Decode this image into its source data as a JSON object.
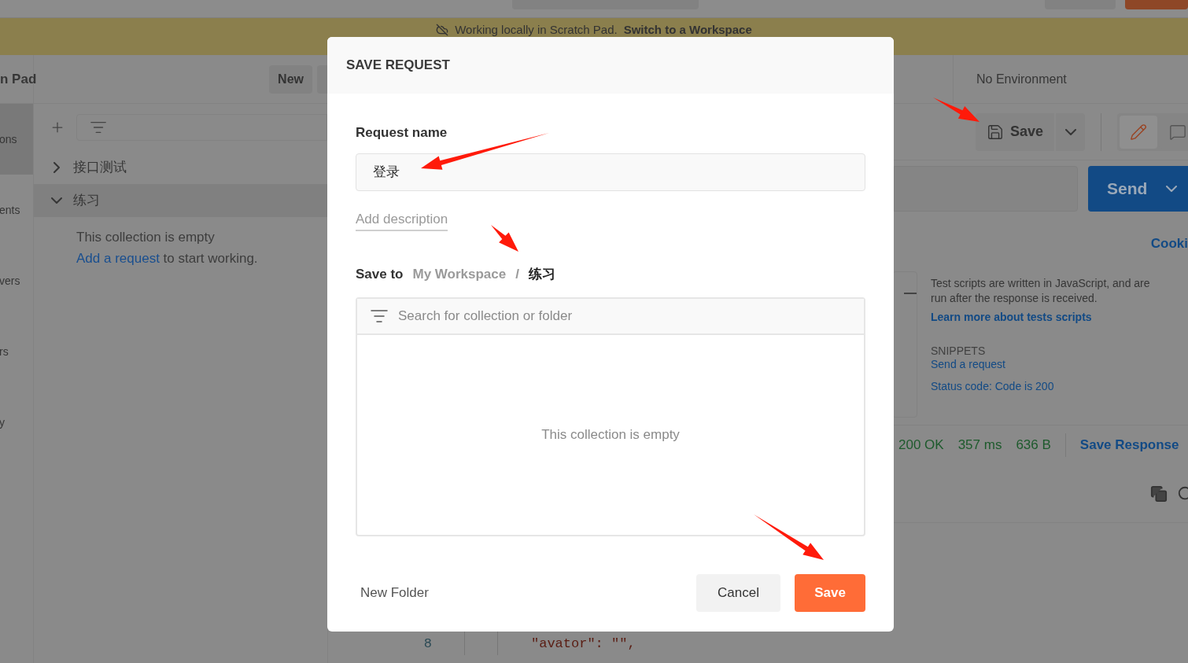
{
  "banner": {
    "text": "Working locally in Scratch Pad.",
    "link": "Switch to a Workspace"
  },
  "sidebar": {
    "items": [
      {
        "label": "ons",
        "selected": true
      },
      {
        "label": "ents",
        "selected": false
      },
      {
        "label": "vers",
        "selected": false
      },
      {
        "label": "rs",
        "selected": false
      },
      {
        "label": "y",
        "selected": false
      }
    ]
  },
  "scratch_pad": {
    "title": "n Pad",
    "new_button": "New",
    "collections": [
      {
        "name": "接口测试",
        "expanded": false
      },
      {
        "name": "练习",
        "expanded": true
      }
    ],
    "empty_text": "This collection is empty",
    "empty_link": "Add a request",
    "empty_after": " to start working."
  },
  "environment": "No Environment",
  "request": {
    "save": "Save",
    "send": "Send",
    "cookies": "Cooki",
    "modes": [
      {
        "kind": "edit",
        "selected": true
      },
      {
        "kind": "comment",
        "selected": false
      }
    ]
  },
  "tests": {
    "description": "Test scripts are written in JavaScript, and are run after the response is received.",
    "link": "Learn more about tests scripts",
    "snippets_title": "SNIPPETS",
    "snippets": [
      "Send a request",
      "Status code: Code is 200"
    ]
  },
  "response": {
    "status": "200 OK",
    "time": "357 ms",
    "size": "636 B",
    "save": "Save Response"
  },
  "code": {
    "line": "8",
    "text": "\"avator\": \"\","
  },
  "dialog": {
    "title": "SAVE REQUEST",
    "name_label": "Request name",
    "name_value": "登录",
    "add_description": "Add description",
    "save_to_label": "Save to",
    "path": [
      {
        "label": "My Workspace",
        "current": false
      },
      {
        "label": "练习",
        "current": true
      }
    ],
    "separator": "/",
    "search_placeholder": "Search for collection or folder",
    "empty_text": "This collection is empty",
    "new_folder": "New Folder",
    "cancel": "Cancel",
    "save": "Save"
  }
}
